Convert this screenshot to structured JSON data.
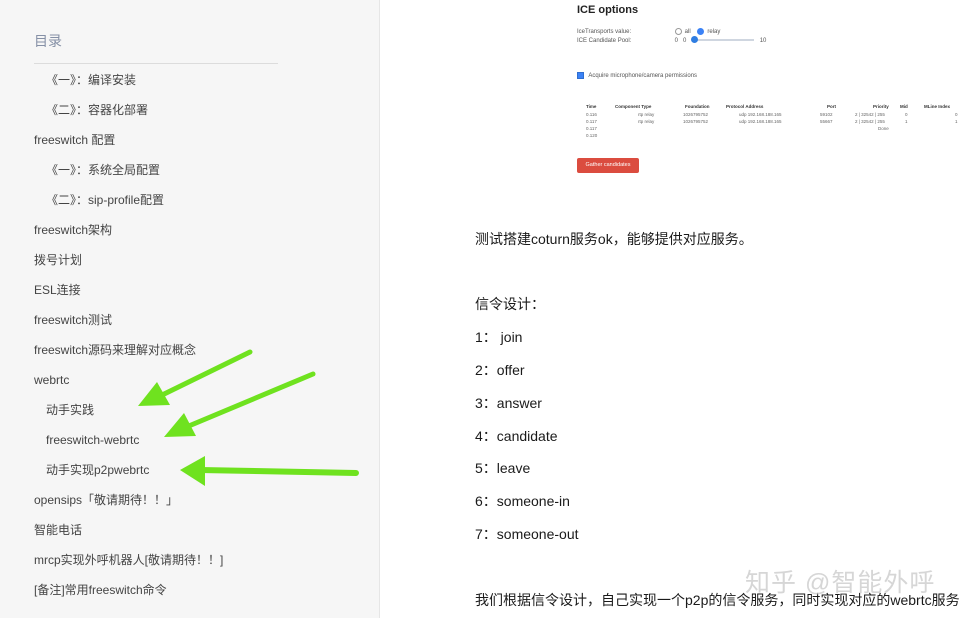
{
  "sidebar": {
    "title": "目录",
    "items": [
      {
        "label": "《一》：编译安装",
        "level": 2
      },
      {
        "label": "《二》：容器化部署",
        "level": 2
      },
      {
        "label": "freeswitch 配置",
        "level": 1
      },
      {
        "label": "《一》：系统全局配置",
        "level": 2
      },
      {
        "label": "《二》：sip-profile配置",
        "level": 2
      },
      {
        "label": "freeswitch架构",
        "level": 1
      },
      {
        "label": "拨号计划",
        "level": 1
      },
      {
        "label": "ESL连接",
        "level": 1
      },
      {
        "label": "freeswitch测试",
        "level": 1
      },
      {
        "label": "freeswitch源码来理解对应概念",
        "level": 1
      },
      {
        "label": "webrtc",
        "level": 1
      },
      {
        "label": "动手实践",
        "level": 2
      },
      {
        "label": "freeswitch-webrtc",
        "level": 2
      },
      {
        "label": "动手实现p2pwebrtc",
        "level": 2
      },
      {
        "label": "opensips「敬请期待！！」",
        "level": 1
      },
      {
        "label": "智能电话",
        "level": 1
      },
      {
        "label": "mrcp实现外呼机器人[敬请期待！！]",
        "level": 1
      },
      {
        "label": "[备注]常用freeswitch命令",
        "level": 1
      }
    ],
    "arrow_color": "#6fe21f"
  },
  "ice": {
    "heading": "ICE options",
    "transports_label": "IceTransports value:",
    "opt_all": "all",
    "opt_relay": "relay",
    "pool_label": "ICE Candidate Pool:",
    "pool_value": "0",
    "pool_min": "0",
    "pool_max": "10",
    "permission_label": "Acquire microphone/camera permissions",
    "table": {
      "headers": [
        "Time",
        "Component Type",
        "Foundation",
        "Protocol Address",
        "Port",
        "Priority",
        "Mid",
        "MLine Index"
      ],
      "rows": [
        [
          "0.116",
          "rtp relay",
          "1026795752",
          "udp 192.168.188.165",
          "59102",
          "2 | 32542 | 255",
          "0",
          "0"
        ],
        [
          "0.117",
          "rtp relay",
          "1026795752",
          "udp 192.168.188.165",
          "55667",
          "2 | 32542 | 255",
          "1",
          "1"
        ],
        [
          "0.117",
          "",
          "",
          "",
          "",
          "Done",
          "",
          ""
        ],
        [
          "0.120",
          "",
          "",
          "",
          "",
          "",
          "",
          ""
        ]
      ]
    },
    "gather_button": "Gather candidates",
    "button_color": "#db4c3f"
  },
  "article": {
    "line1": "测试搭建coturn服务ok，能够提供对应服务。",
    "signal_title": "信令设计：",
    "signals": [
      "1： join",
      "2：offer",
      "3：answer",
      "4：candidate",
      "5：leave",
      "6：someone-in",
      "7：someone-out"
    ],
    "line_last": "我们根据信令设计，自己实现一个p2p的信令服务，同时实现对应的webrtc服务"
  },
  "watermark": "知乎 @智能外呼"
}
